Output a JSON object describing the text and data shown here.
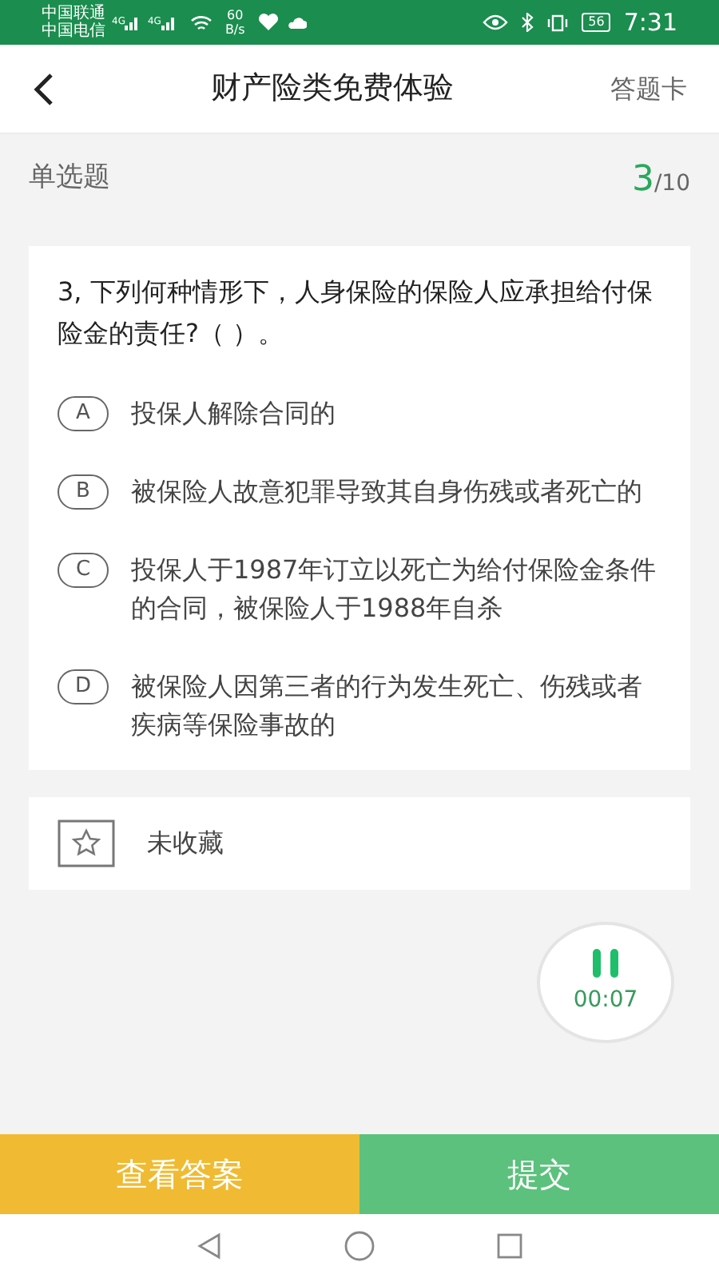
{
  "status_bar": {
    "carriers": [
      "中国联通",
      "中国电信"
    ],
    "network": [
      "4G",
      "4G"
    ],
    "speed": "60",
    "speed_unit": "B/s",
    "battery": "56",
    "time": "7:31"
  },
  "header": {
    "title": "财产险类免费体验",
    "action": "答题卡"
  },
  "question_type": {
    "label": "单选题",
    "current": "3",
    "total": "/10"
  },
  "question": {
    "text": "3, 下列何种情形下，人身保险的保险人应承担给付保险金的责任?（  ）。",
    "options": [
      {
        "letter": "A",
        "text": "投保人解除合同的",
        "selected": false
      },
      {
        "letter": "B",
        "text": "被保险人故意犯罪导致其自身伤残或者死亡的",
        "selected": false
      },
      {
        "letter": "C",
        "text": "投保人于1987年订立以死亡为给付保险金条件的合同，被保险人于1988年自杀",
        "selected": false
      },
      {
        "letter": "D",
        "text": "被保险人因第三者的行为发生死亡、伤残或者疾病等保险事故的",
        "selected": false
      }
    ]
  },
  "favorite": {
    "label": "未收藏",
    "starred": false
  },
  "timer": {
    "time": "00:07"
  },
  "buttons": [
    {
      "kind": "answer",
      "label": "查看答案"
    },
    {
      "kind": "submit",
      "label": "提交"
    }
  ]
}
